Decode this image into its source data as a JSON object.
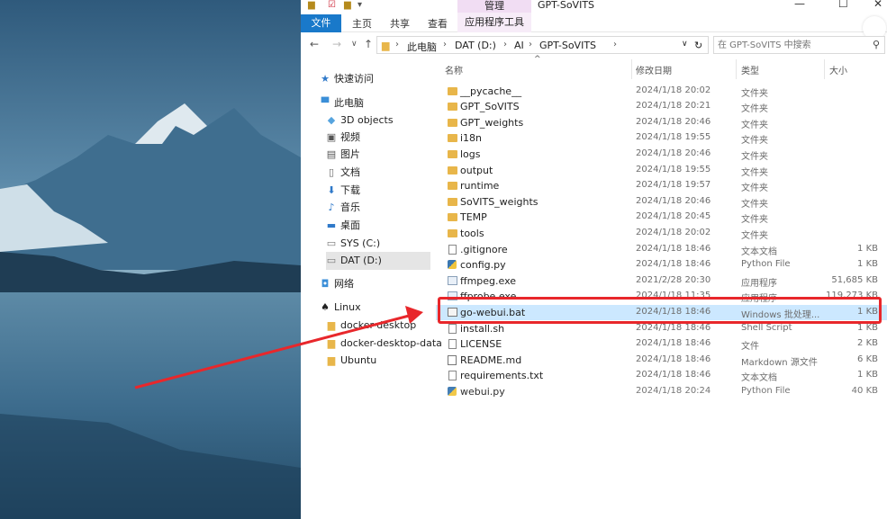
{
  "window": {
    "title": "GPT-SoVITS",
    "manage_label": "管理",
    "controls": {
      "minimize": "—",
      "maximize": "☐",
      "close": "✕"
    }
  },
  "ribbon": {
    "tabs": [
      {
        "label": "文件",
        "selected": true
      },
      {
        "label": "主页"
      },
      {
        "label": "共享"
      },
      {
        "label": "查看"
      },
      {
        "label": "应用程序工具"
      }
    ]
  },
  "address": {
    "crumbs": [
      "此电脑",
      "DAT (D:)",
      "AI",
      "GPT-SoVITS"
    ],
    "search_placeholder": "在 GPT-SoVITS 中搜索"
  },
  "nav_pane": {
    "items": [
      {
        "label": "快速访问",
        "icon": "star-icon"
      },
      {
        "label": "此电脑",
        "icon": "computer-icon"
      },
      {
        "label": "3D objects",
        "icon": "cube-icon"
      },
      {
        "label": "视频",
        "icon": "video-icon"
      },
      {
        "label": "图片",
        "icon": "picture-icon"
      },
      {
        "label": "文档",
        "icon": "document-icon"
      },
      {
        "label": "下载",
        "icon": "download-icon"
      },
      {
        "label": "音乐",
        "icon": "music-icon"
      },
      {
        "label": "桌面",
        "icon": "desktop-icon"
      },
      {
        "label": "SYS (C:)",
        "icon": "drive-icon"
      },
      {
        "label": "DAT (D:)",
        "icon": "drive-icon",
        "selected": true
      },
      {
        "label": "网络",
        "icon": "network-icon"
      },
      {
        "label": "Linux",
        "icon": "linux-icon"
      },
      {
        "label": "docker-desktop",
        "icon": "folder-icon"
      },
      {
        "label": "docker-desktop-data",
        "icon": "folder-icon"
      },
      {
        "label": "Ubuntu",
        "icon": "folder-icon"
      }
    ]
  },
  "file_list": {
    "columns": [
      "名称",
      "修改日期",
      "类型",
      "大小"
    ],
    "rows": [
      {
        "name": "__pycache__",
        "date": "2024/1/18 20:02",
        "type": "文件夹",
        "size": "",
        "icon": "folder"
      },
      {
        "name": "GPT_SoVITS",
        "date": "2024/1/18 20:21",
        "type": "文件夹",
        "size": "",
        "icon": "folder"
      },
      {
        "name": "GPT_weights",
        "date": "2024/1/18 20:46",
        "type": "文件夹",
        "size": "",
        "icon": "folder"
      },
      {
        "name": "i18n",
        "date": "2024/1/18 19:55",
        "type": "文件夹",
        "size": "",
        "icon": "folder"
      },
      {
        "name": "logs",
        "date": "2024/1/18 20:46",
        "type": "文件夹",
        "size": "",
        "icon": "folder"
      },
      {
        "name": "output",
        "date": "2024/1/18 19:55",
        "type": "文件夹",
        "size": "",
        "icon": "folder"
      },
      {
        "name": "runtime",
        "date": "2024/1/18 19:57",
        "type": "文件夹",
        "size": "",
        "icon": "folder"
      },
      {
        "name": "SoVITS_weights",
        "date": "2024/1/18 20:46",
        "type": "文件夹",
        "size": "",
        "icon": "folder"
      },
      {
        "name": "TEMP",
        "date": "2024/1/18 20:45",
        "type": "文件夹",
        "size": "",
        "icon": "folder"
      },
      {
        "name": "tools",
        "date": "2024/1/18 20:02",
        "type": "文件夹",
        "size": "",
        "icon": "folder"
      },
      {
        "name": ".gitignore",
        "date": "2024/1/18 18:46",
        "type": "文本文档",
        "size": "1 KB",
        "icon": "doc"
      },
      {
        "name": "config.py",
        "date": "2024/1/18 18:46",
        "type": "Python File",
        "size": "1 KB",
        "icon": "py"
      },
      {
        "name": "ffmpeg.exe",
        "date": "2021/2/28 20:30",
        "type": "应用程序",
        "size": "51,685 KB",
        "icon": "exe"
      },
      {
        "name": "ffprobe.exe",
        "date": "2024/1/18 11:35",
        "type": "应用程序",
        "size": "119,273 KB",
        "icon": "exe"
      },
      {
        "name": "go-webui.bat",
        "date": "2024/1/18 18:46",
        "type": "Windows 批处理...",
        "size": "1 KB",
        "icon": "bat",
        "selected": true
      },
      {
        "name": "install.sh",
        "date": "2024/1/18 18:46",
        "type": "Shell Script",
        "size": "1 KB",
        "icon": "doc"
      },
      {
        "name": "LICENSE",
        "date": "2024/1/18 18:46",
        "type": "文件",
        "size": "2 KB",
        "icon": "doc"
      },
      {
        "name": "README.md",
        "date": "2024/1/18 18:46",
        "type": "Markdown 源文件",
        "size": "6 KB",
        "icon": "md"
      },
      {
        "name": "requirements.txt",
        "date": "2024/1/18 18:46",
        "type": "文本文档",
        "size": "1 KB",
        "icon": "doc"
      },
      {
        "name": "webui.py",
        "date": "2024/1/18 20:24",
        "type": "Python File",
        "size": "40 KB",
        "icon": "py"
      }
    ]
  },
  "colors": {
    "highlight_box": "#e8272b",
    "selection": "#cce8ff",
    "file_tab": "#1979ca",
    "folder": "#e8b64a"
  }
}
